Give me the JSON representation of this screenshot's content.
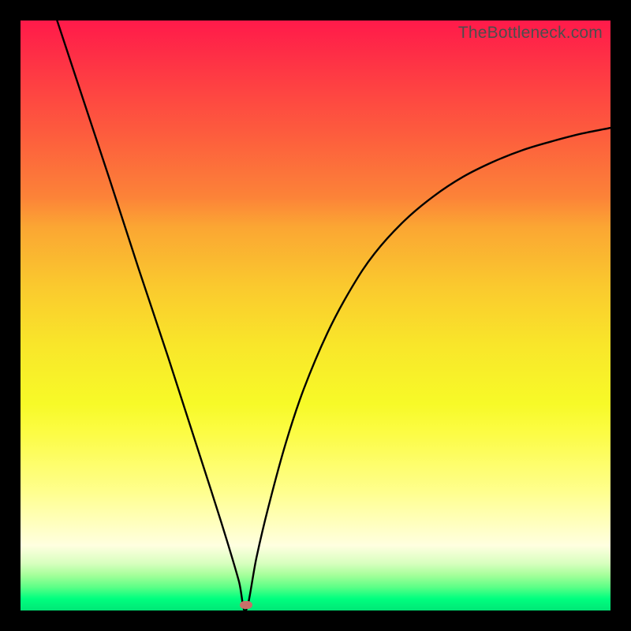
{
  "watermark": "TheBottleneck.com",
  "chart_data": {
    "type": "line",
    "title": "",
    "xlabel": "",
    "ylabel": "",
    "xlim": [
      0,
      1
    ],
    "ylim": [
      0,
      1
    ],
    "series": [
      {
        "name": "left-branch",
        "x": [
          0.062,
          0.1,
          0.15,
          0.2,
          0.25,
          0.3,
          0.33,
          0.35,
          0.37,
          0.382
        ],
        "values": [
          1.0,
          0.885,
          0.734,
          0.58,
          0.43,
          0.275,
          0.182,
          0.118,
          0.05,
          0.0
        ]
      },
      {
        "name": "right-branch",
        "x": [
          0.382,
          0.4,
          0.42,
          0.45,
          0.48,
          0.52,
          0.56,
          0.6,
          0.65,
          0.7,
          0.75,
          0.8,
          0.85,
          0.9,
          0.95,
          1.0
        ],
        "values": [
          0.0,
          0.09,
          0.175,
          0.285,
          0.375,
          0.47,
          0.545,
          0.605,
          0.66,
          0.702,
          0.735,
          0.76,
          0.78,
          0.795,
          0.808,
          0.818
        ]
      }
    ],
    "marker": {
      "x": 0.382,
      "y": 0.01
    },
    "background_gradient": {
      "top": "#ff1a4a",
      "mid": "#f9e62a",
      "bottom": "#00e676"
    }
  }
}
